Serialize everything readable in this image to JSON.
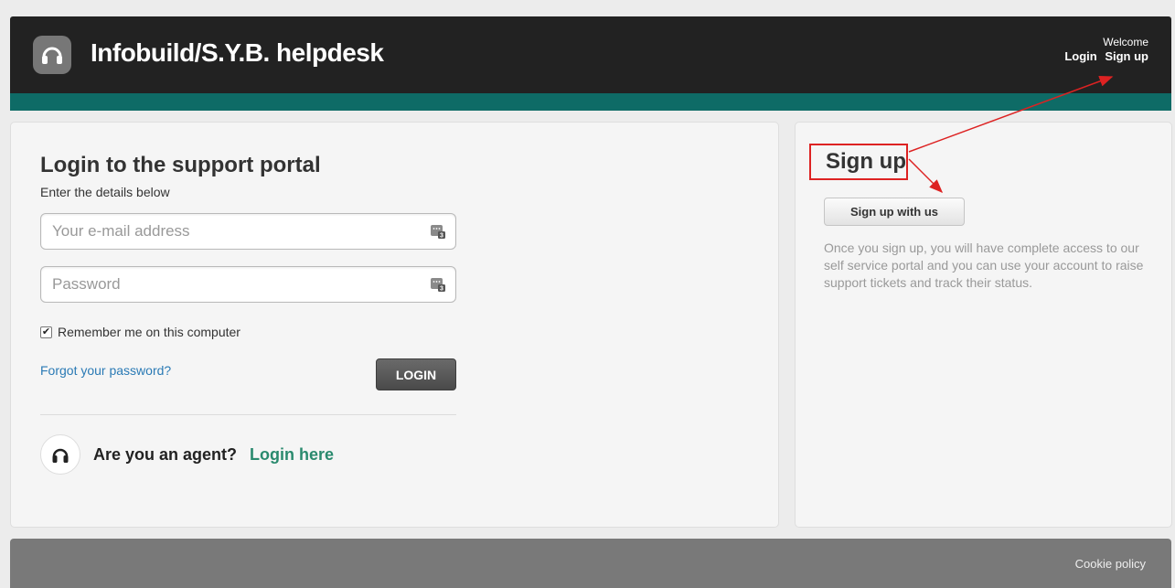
{
  "header": {
    "title": "Infobuild/S.Y.B. helpdesk",
    "welcome": "Welcome",
    "login_link": "Login",
    "signup_link": "Sign up",
    "logo_icon": "headset-icon",
    "bar_color": "#222222",
    "accent_color": "#0e6b66"
  },
  "login": {
    "heading": "Login to the support portal",
    "subheading": "Enter the details below",
    "email_placeholder": "Your e-mail address",
    "email_value": "",
    "password_placeholder": "Password",
    "password_value": "",
    "remember_label": "Remember me on this computer",
    "remember_checked": true,
    "forgot_link": "Forgot your password?",
    "login_button": "LOGIN",
    "agent_question": "Are you an agent?",
    "agent_link": "Login here"
  },
  "signup": {
    "heading": "Sign up",
    "button": "Sign up with us",
    "description": "Once you sign up, you will have complete access to our self service portal and you can use your account to raise support tickets and track their status."
  },
  "footer": {
    "cookie_link": "Cookie policy"
  },
  "annotation": {
    "highlight_color": "#dd2222"
  }
}
